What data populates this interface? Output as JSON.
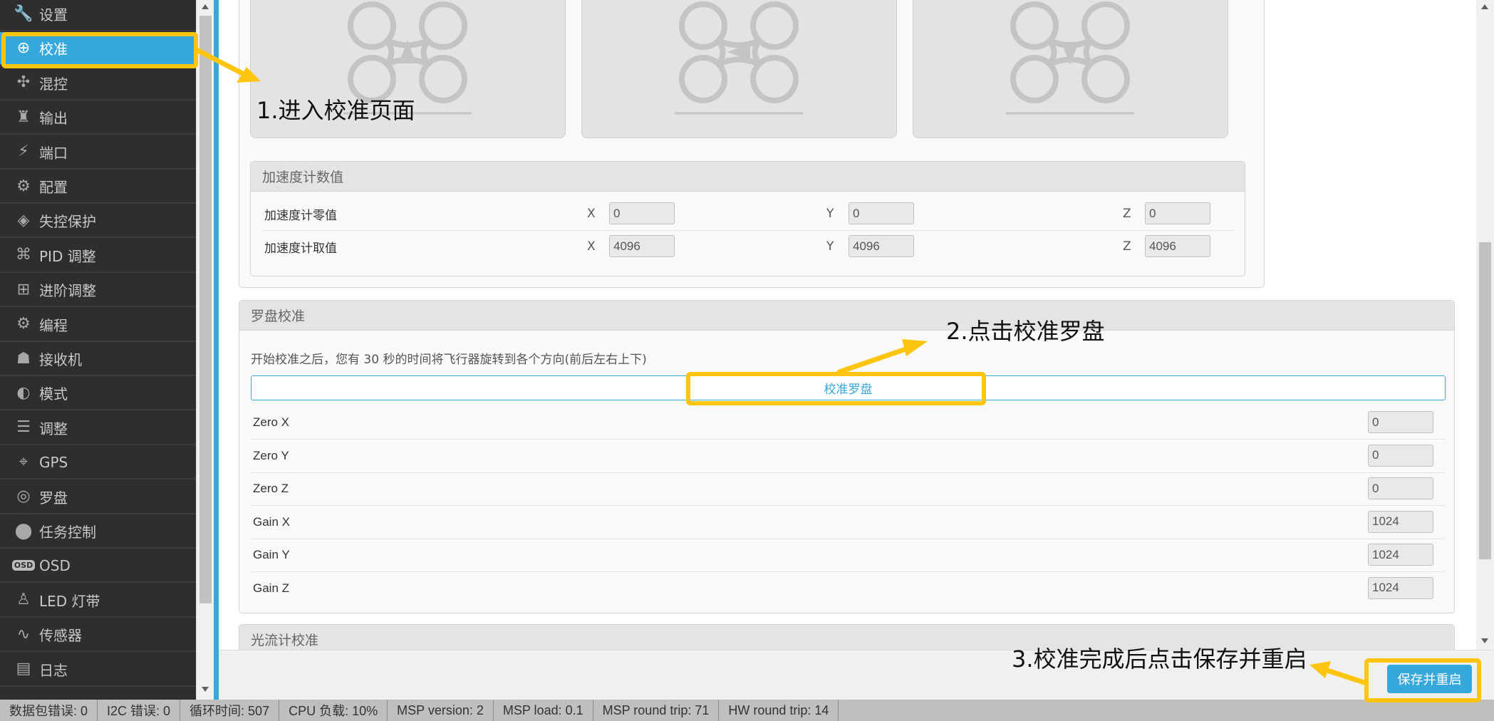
{
  "sidebar": {
    "items": [
      {
        "label": "设置",
        "icon": "wrench-icon"
      },
      {
        "label": "校准",
        "icon": "crosshair-icon"
      },
      {
        "label": "混控",
        "icon": "drone-icon"
      },
      {
        "label": "输出",
        "icon": "motor-icon"
      },
      {
        "label": "端口",
        "icon": "plug-icon"
      },
      {
        "label": "配置",
        "icon": "gear-icon"
      },
      {
        "label": "失控保护",
        "icon": "diamond-icon"
      },
      {
        "label": "PID 调整",
        "icon": "hierarchy-icon"
      },
      {
        "label": "进阶调整",
        "icon": "tree-icon"
      },
      {
        "label": "编程",
        "icon": "gear-icon"
      },
      {
        "label": "接收机",
        "icon": "robot-icon"
      },
      {
        "label": "模式",
        "icon": "toggle-icon"
      },
      {
        "label": "调整",
        "icon": "sliders-icon"
      },
      {
        "label": "GPS",
        "icon": "satellite-icon"
      },
      {
        "label": "罗盘",
        "icon": "compass-icon"
      },
      {
        "label": "任务控制",
        "icon": "map-pin-icon"
      },
      {
        "label": "OSD",
        "icon": "osd-icon"
      },
      {
        "label": "LED 灯带",
        "icon": "led-icon"
      },
      {
        "label": "传感器",
        "icon": "pulse-icon"
      },
      {
        "label": "日志",
        "icon": "log-icon"
      }
    ],
    "active_index": 1
  },
  "accelerometer": {
    "title": "加速度计数值",
    "rows": [
      {
        "label": "加速度计零值",
        "x_label": "X",
        "x": "0",
        "y_label": "Y",
        "y": "0",
        "z_label": "Z",
        "z": "0"
      },
      {
        "label": "加速度计取值",
        "x_label": "X",
        "x": "4096",
        "y_label": "Y",
        "y": "4096",
        "z_label": "Z",
        "z": "4096"
      }
    ]
  },
  "compass": {
    "title": "罗盘校准",
    "description": "开始校准之后，您有 30 秒的时间将飞行器旋转到各个方向(前后左右上下)",
    "button_label": "校准罗盘",
    "rows": [
      {
        "label": "Zero X",
        "value": "0"
      },
      {
        "label": "Zero Y",
        "value": "0"
      },
      {
        "label": "Zero Z",
        "value": "0"
      },
      {
        "label": "Gain X",
        "value": "1024"
      },
      {
        "label": "Gain Y",
        "value": "1024"
      },
      {
        "label": "Gain Z",
        "value": "1024"
      }
    ]
  },
  "optical_flow": {
    "title": "光流计校准"
  },
  "toolbar": {
    "save_label": "保存并重启"
  },
  "status_bar": [
    "数据包错误: 0",
    "I2C 错误: 0",
    "循环时间: 507",
    "CPU 负载: 10%",
    "MSP version: 2",
    "MSP load: 0.1",
    "MSP round trip: 71",
    "HW round trip: 14"
  ],
  "annotations": {
    "step1": "1.进入校准页面",
    "step2": "2.点击校准罗盘",
    "step3": "3.校准完成后点击保存并重启"
  },
  "colors": {
    "accent": "#37a8db",
    "sidebar_bg": "#2e2e2e",
    "highlight": "#fdc50f"
  }
}
